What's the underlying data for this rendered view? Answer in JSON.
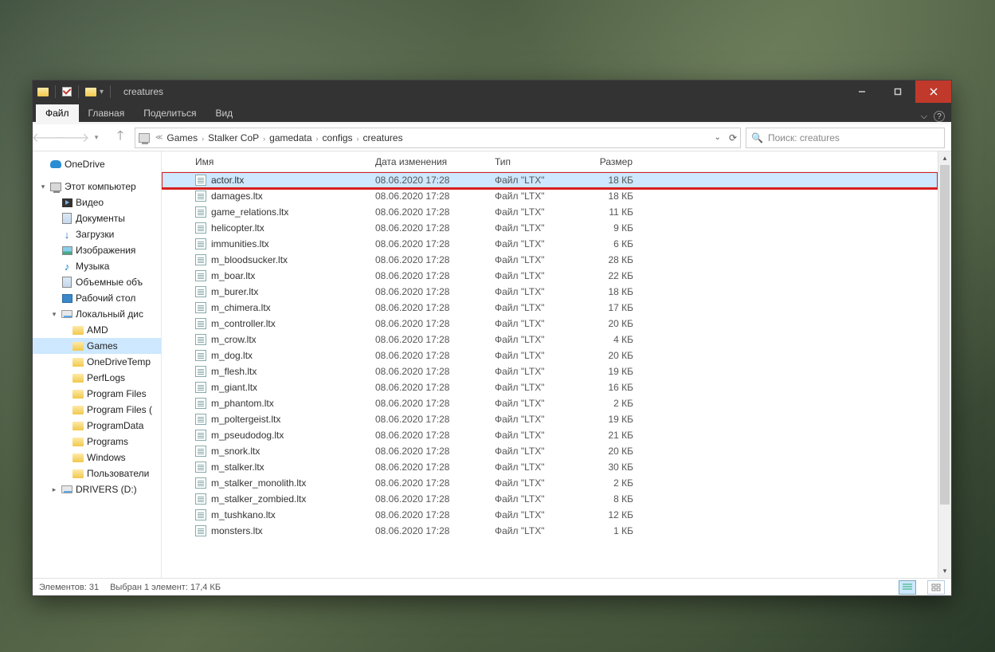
{
  "titlebar": {
    "title": "creatures"
  },
  "ribbon": {
    "tabs": [
      "Файл",
      "Главная",
      "Поделиться",
      "Вид"
    ],
    "active_index": 0
  },
  "breadcrumbs": [
    "Games",
    "Stalker CoP",
    "gamedata",
    "configs",
    "creatures"
  ],
  "search": {
    "placeholder": "Поиск: creatures"
  },
  "columns": {
    "name": "Имя",
    "date": "Дата изменения",
    "type": "Тип",
    "size": "Размер"
  },
  "navpane": [
    {
      "label": "OneDrive",
      "icon": "onedrive",
      "indent": 0,
      "exp": ""
    },
    {
      "label": "",
      "spacer": true
    },
    {
      "label": "Этот компьютер",
      "icon": "pc",
      "indent": 0,
      "exp": "▾"
    },
    {
      "label": "Видео",
      "icon": "vid",
      "indent": 1,
      "exp": ""
    },
    {
      "label": "Документы",
      "icon": "lib",
      "indent": 1,
      "exp": ""
    },
    {
      "label": "Загрузки",
      "icon": "dl",
      "indent": 1,
      "exp": ""
    },
    {
      "label": "Изображения",
      "icon": "img",
      "indent": 1,
      "exp": ""
    },
    {
      "label": "Музыка",
      "icon": "music",
      "indent": 1,
      "exp": ""
    },
    {
      "label": "Объемные объ",
      "icon": "lib",
      "indent": 1,
      "exp": ""
    },
    {
      "label": "Рабочий стол",
      "icon": "desk",
      "indent": 1,
      "exp": ""
    },
    {
      "label": "Локальный дис",
      "icon": "drive",
      "indent": 1,
      "exp": "▾"
    },
    {
      "label": "AMD",
      "icon": "folder",
      "indent": 2,
      "exp": ""
    },
    {
      "label": "Games",
      "icon": "folder",
      "indent": 2,
      "exp": "",
      "selected": true
    },
    {
      "label": "OneDriveTemp",
      "icon": "folder",
      "indent": 2,
      "exp": ""
    },
    {
      "label": "PerfLogs",
      "icon": "folder",
      "indent": 2,
      "exp": ""
    },
    {
      "label": "Program Files",
      "icon": "folder",
      "indent": 2,
      "exp": ""
    },
    {
      "label": "Program Files (",
      "icon": "folder",
      "indent": 2,
      "exp": ""
    },
    {
      "label": "ProgramData",
      "icon": "folder",
      "indent": 2,
      "exp": ""
    },
    {
      "label": "Programs",
      "icon": "folder",
      "indent": 2,
      "exp": ""
    },
    {
      "label": "Windows",
      "icon": "folder",
      "indent": 2,
      "exp": ""
    },
    {
      "label": "Пользователи",
      "icon": "folder",
      "indent": 2,
      "exp": ""
    },
    {
      "label": "DRIVERS (D:)",
      "icon": "drive",
      "indent": 1,
      "exp": "▸"
    }
  ],
  "files": [
    {
      "name": "actor.ltx",
      "date": "08.06.2020 17:28",
      "type": "Файл \"LTX\"",
      "size": "18 КБ",
      "selected": true,
      "highlight": true
    },
    {
      "name": "damages.ltx",
      "date": "08.06.2020 17:28",
      "type": "Файл \"LTX\"",
      "size": "18 КБ"
    },
    {
      "name": "game_relations.ltx",
      "date": "08.06.2020 17:28",
      "type": "Файл \"LTX\"",
      "size": "11 КБ"
    },
    {
      "name": "helicopter.ltx",
      "date": "08.06.2020 17:28",
      "type": "Файл \"LTX\"",
      "size": "9 КБ"
    },
    {
      "name": "immunities.ltx",
      "date": "08.06.2020 17:28",
      "type": "Файл \"LTX\"",
      "size": "6 КБ"
    },
    {
      "name": "m_bloodsucker.ltx",
      "date": "08.06.2020 17:28",
      "type": "Файл \"LTX\"",
      "size": "28 КБ"
    },
    {
      "name": "m_boar.ltx",
      "date": "08.06.2020 17:28",
      "type": "Файл \"LTX\"",
      "size": "22 КБ"
    },
    {
      "name": "m_burer.ltx",
      "date": "08.06.2020 17:28",
      "type": "Файл \"LTX\"",
      "size": "18 КБ"
    },
    {
      "name": "m_chimera.ltx",
      "date": "08.06.2020 17:28",
      "type": "Файл \"LTX\"",
      "size": "17 КБ"
    },
    {
      "name": "m_controller.ltx",
      "date": "08.06.2020 17:28",
      "type": "Файл \"LTX\"",
      "size": "20 КБ"
    },
    {
      "name": "m_crow.ltx",
      "date": "08.06.2020 17:28",
      "type": "Файл \"LTX\"",
      "size": "4 КБ"
    },
    {
      "name": "m_dog.ltx",
      "date": "08.06.2020 17:28",
      "type": "Файл \"LTX\"",
      "size": "20 КБ"
    },
    {
      "name": "m_flesh.ltx",
      "date": "08.06.2020 17:28",
      "type": "Файл \"LTX\"",
      "size": "19 КБ"
    },
    {
      "name": "m_giant.ltx",
      "date": "08.06.2020 17:28",
      "type": "Файл \"LTX\"",
      "size": "16 КБ"
    },
    {
      "name": "m_phantom.ltx",
      "date": "08.06.2020 17:28",
      "type": "Файл \"LTX\"",
      "size": "2 КБ"
    },
    {
      "name": "m_poltergeist.ltx",
      "date": "08.06.2020 17:28",
      "type": "Файл \"LTX\"",
      "size": "19 КБ"
    },
    {
      "name": "m_pseudodog.ltx",
      "date": "08.06.2020 17:28",
      "type": "Файл \"LTX\"",
      "size": "21 КБ"
    },
    {
      "name": "m_snork.ltx",
      "date": "08.06.2020 17:28",
      "type": "Файл \"LTX\"",
      "size": "20 КБ"
    },
    {
      "name": "m_stalker.ltx",
      "date": "08.06.2020 17:28",
      "type": "Файл \"LTX\"",
      "size": "30 КБ"
    },
    {
      "name": "m_stalker_monolith.ltx",
      "date": "08.06.2020 17:28",
      "type": "Файл \"LTX\"",
      "size": "2 КБ"
    },
    {
      "name": "m_stalker_zombied.ltx",
      "date": "08.06.2020 17:28",
      "type": "Файл \"LTX\"",
      "size": "8 КБ"
    },
    {
      "name": "m_tushkano.ltx",
      "date": "08.06.2020 17:28",
      "type": "Файл \"LTX\"",
      "size": "12 КБ"
    },
    {
      "name": "monsters.ltx",
      "date": "08.06.2020 17:28",
      "type": "Файл \"LTX\"",
      "size": "1 КБ"
    }
  ],
  "status": {
    "count": "Элементов: 31",
    "selection": "Выбран 1 элемент: 17,4 КБ"
  }
}
